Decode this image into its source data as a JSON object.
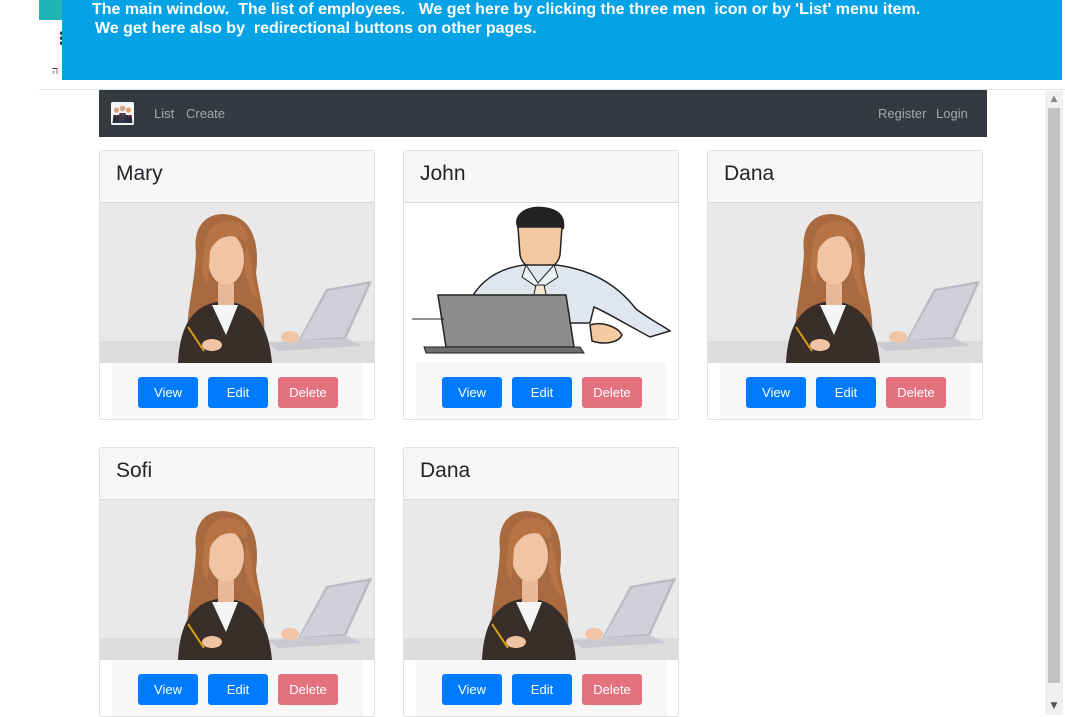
{
  "annotation": {
    "line1": "The main window.  The list of employees.   We get here by clicking the three men  icon or by 'List' menu item.",
    "line2": "We get here also by  redirectional buttons on other pages."
  },
  "background": {
    "hebrew_char": "ה"
  },
  "navbar": {
    "brand_icon": "three-men-icon",
    "links": {
      "list": "List",
      "create": "Create",
      "register": "Register",
      "login": "Login"
    }
  },
  "employees": [
    {
      "name": "Mary",
      "image": "woman-at-laptop"
    },
    {
      "name": "John",
      "image": "man-at-laptop"
    },
    {
      "name": "Dana",
      "image": "woman-at-laptop"
    },
    {
      "name": "Sofi",
      "image": "woman-at-laptop"
    },
    {
      "name": "Dana",
      "image": "woman-at-laptop"
    }
  ],
  "buttons": {
    "view": "View",
    "edit": "Edit",
    "delete": "Delete"
  },
  "colors": {
    "annotation_bg": "#05a3e6",
    "navbar_bg": "#343a40",
    "primary": "#007bff",
    "danger_faded": "#e4727e"
  }
}
